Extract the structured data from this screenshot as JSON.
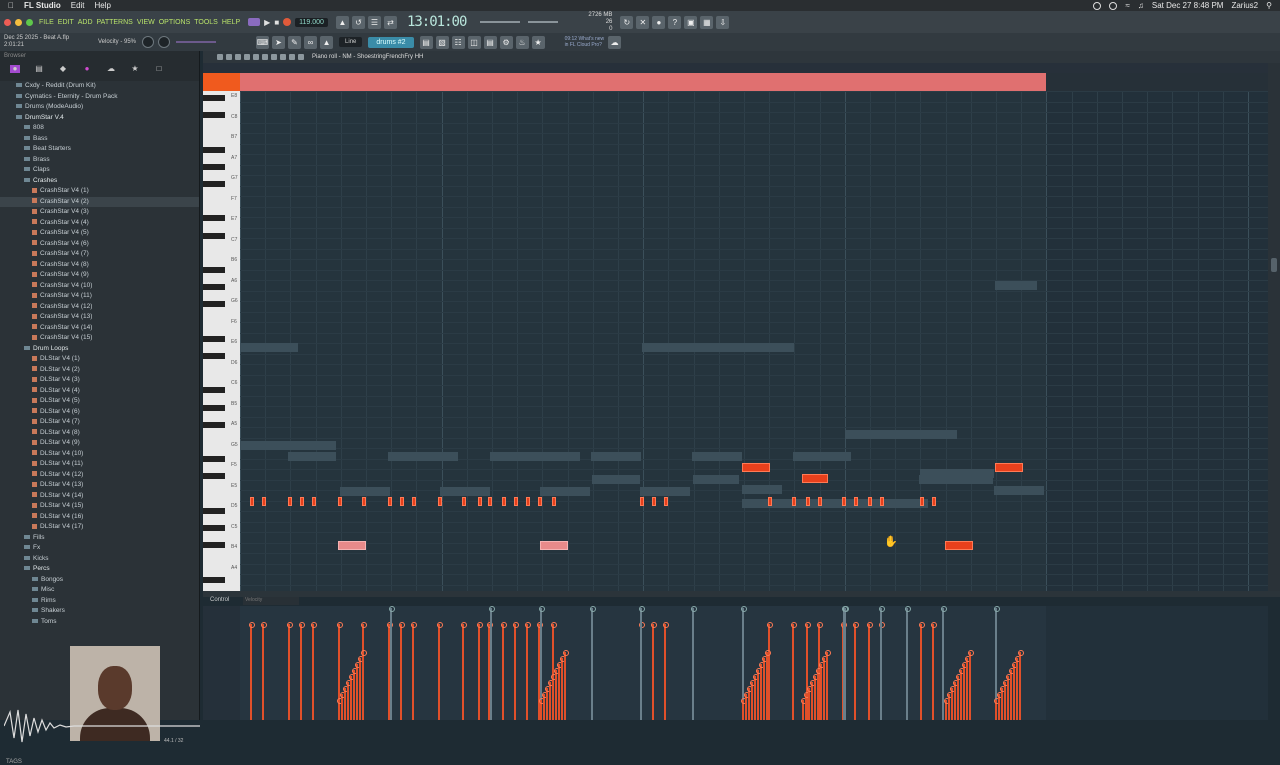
{
  "menubar": {
    "app": "FL Studio",
    "items": [
      "Edit",
      "Help"
    ],
    "datetime": "Sat Dec 27  8:48 PM",
    "user": "Zarius2"
  },
  "toolbar": {
    "menu": [
      "FILE",
      "EDIT",
      "ADD",
      "PATTERNS",
      "VIEW",
      "OPTIONS",
      "TOOLS",
      "HELP"
    ],
    "tempo": "119.000",
    "time": "13:01:00",
    "cpu_line1": "2726 MB",
    "cpu_line2": "26",
    "cpu_line3": "0"
  },
  "toolbar2": {
    "project_info_line1": "Dec 25 2025 - Beat A.flp",
    "project_info_line2": "2:01:21",
    "velocity_label": "Velocity - 95%",
    "snap": "Line",
    "pattern": "drums #2",
    "news_line1": "09:12 What's new",
    "news_line2": "in FL Cloud Pro?"
  },
  "browser": {
    "header": "Browser",
    "tree": [
      {
        "label": "Cxdy - Reddit (Drum Kit)",
        "kind": "folder",
        "indent": 1
      },
      {
        "label": "Cymatics - Eternity - Drum Pack",
        "kind": "folder",
        "indent": 1
      },
      {
        "label": "Drums (ModeAudio)",
        "kind": "folder",
        "indent": 1
      },
      {
        "label": "DrumStar V.4",
        "kind": "folder",
        "indent": 1,
        "open": true
      },
      {
        "label": "808",
        "kind": "folder",
        "indent": 2
      },
      {
        "label": "Bass",
        "kind": "folder",
        "indent": 2
      },
      {
        "label": "Beat Starters",
        "kind": "folder",
        "indent": 2
      },
      {
        "label": "Brass",
        "kind": "folder",
        "indent": 2
      },
      {
        "label": "Claps",
        "kind": "folder",
        "indent": 2
      },
      {
        "label": "Crashes",
        "kind": "folder",
        "indent": 2,
        "open": true
      },
      {
        "label": "CrashStar V4 (1)",
        "kind": "file",
        "indent": 3
      },
      {
        "label": "CrashStar V4 (2)",
        "kind": "file",
        "indent": 3,
        "selected": true
      },
      {
        "label": "CrashStar V4 (3)",
        "kind": "file",
        "indent": 3
      },
      {
        "label": "CrashStar V4 (4)",
        "kind": "file",
        "indent": 3
      },
      {
        "label": "CrashStar V4 (5)",
        "kind": "file",
        "indent": 3
      },
      {
        "label": "CrashStar V4 (6)",
        "kind": "file",
        "indent": 3
      },
      {
        "label": "CrashStar V4 (7)",
        "kind": "file",
        "indent": 3
      },
      {
        "label": "CrashStar V4 (8)",
        "kind": "file",
        "indent": 3
      },
      {
        "label": "CrashStar V4 (9)",
        "kind": "file",
        "indent": 3
      },
      {
        "label": "CrashStar V4 (10)",
        "kind": "file",
        "indent": 3
      },
      {
        "label": "CrashStar V4 (11)",
        "kind": "file",
        "indent": 3
      },
      {
        "label": "CrashStar V4 (12)",
        "kind": "file",
        "indent": 3
      },
      {
        "label": "CrashStar V4 (13)",
        "kind": "file",
        "indent": 3
      },
      {
        "label": "CrashStar V4 (14)",
        "kind": "file",
        "indent": 3
      },
      {
        "label": "CrashStar V4 (15)",
        "kind": "file",
        "indent": 3
      },
      {
        "label": "Drum Loops",
        "kind": "folder",
        "indent": 2,
        "open": true
      },
      {
        "label": "DLStar V4 (1)",
        "kind": "file",
        "indent": 3
      },
      {
        "label": "DLStar V4 (2)",
        "kind": "file",
        "indent": 3
      },
      {
        "label": "DLStar V4 (3)",
        "kind": "file",
        "indent": 3
      },
      {
        "label": "DLStar V4 (4)",
        "kind": "file",
        "indent": 3
      },
      {
        "label": "DLStar V4 (5)",
        "kind": "file",
        "indent": 3
      },
      {
        "label": "DLStar V4 (6)",
        "kind": "file",
        "indent": 3
      },
      {
        "label": "DLStar V4 (7)",
        "kind": "file",
        "indent": 3
      },
      {
        "label": "DLStar V4 (8)",
        "kind": "file",
        "indent": 3
      },
      {
        "label": "DLStar V4 (9)",
        "kind": "file",
        "indent": 3
      },
      {
        "label": "DLStar V4 (10)",
        "kind": "file",
        "indent": 3
      },
      {
        "label": "DLStar V4 (11)",
        "kind": "file",
        "indent": 3
      },
      {
        "label": "DLStar V4 (12)",
        "kind": "file",
        "indent": 3
      },
      {
        "label": "DLStar V4 (13)",
        "kind": "file",
        "indent": 3
      },
      {
        "label": "DLStar V4 (14)",
        "kind": "file",
        "indent": 3
      },
      {
        "label": "DLStar V4 (15)",
        "kind": "file",
        "indent": 3
      },
      {
        "label": "DLStar V4 (16)",
        "kind": "file",
        "indent": 3
      },
      {
        "label": "DLStar V4 (17)",
        "kind": "file",
        "indent": 3
      },
      {
        "label": "Fills",
        "kind": "folder",
        "indent": 2
      },
      {
        "label": "Fx",
        "kind": "folder",
        "indent": 2
      },
      {
        "label": "Kicks",
        "kind": "folder",
        "indent": 2
      },
      {
        "label": "Percs",
        "kind": "folder",
        "indent": 2,
        "open": true
      },
      {
        "label": "Bongos",
        "kind": "folder",
        "indent": 3
      },
      {
        "label": "Misc",
        "kind": "folder",
        "indent": 3
      },
      {
        "label": "Rims",
        "kind": "folder",
        "indent": 3
      },
      {
        "label": "Shakers",
        "kind": "folder",
        "indent": 3
      },
      {
        "label": "Toms",
        "kind": "folder",
        "indent": 3
      }
    ],
    "sample_info": "44.1 / 32",
    "tags": "TAGS"
  },
  "piano_roll": {
    "title": "Piano roll - NM - ShoestringFrenchFry HH",
    "key_labels": [
      "E8",
      "C8",
      "B7",
      "A7",
      "G7",
      "F7",
      "E7",
      "C7",
      "B6",
      "A6",
      "G6",
      "F6",
      "E6",
      "D6",
      "C6",
      "B5",
      "A5",
      "G5",
      "F5",
      "E5",
      "D5",
      "C5",
      "B4",
      "A4"
    ],
    "control_label": "Control",
    "control_target": "Velocity"
  },
  "colors": {
    "note": "#e8401c",
    "loop_bar": "#e07070",
    "accent": "#f05a1e"
  }
}
